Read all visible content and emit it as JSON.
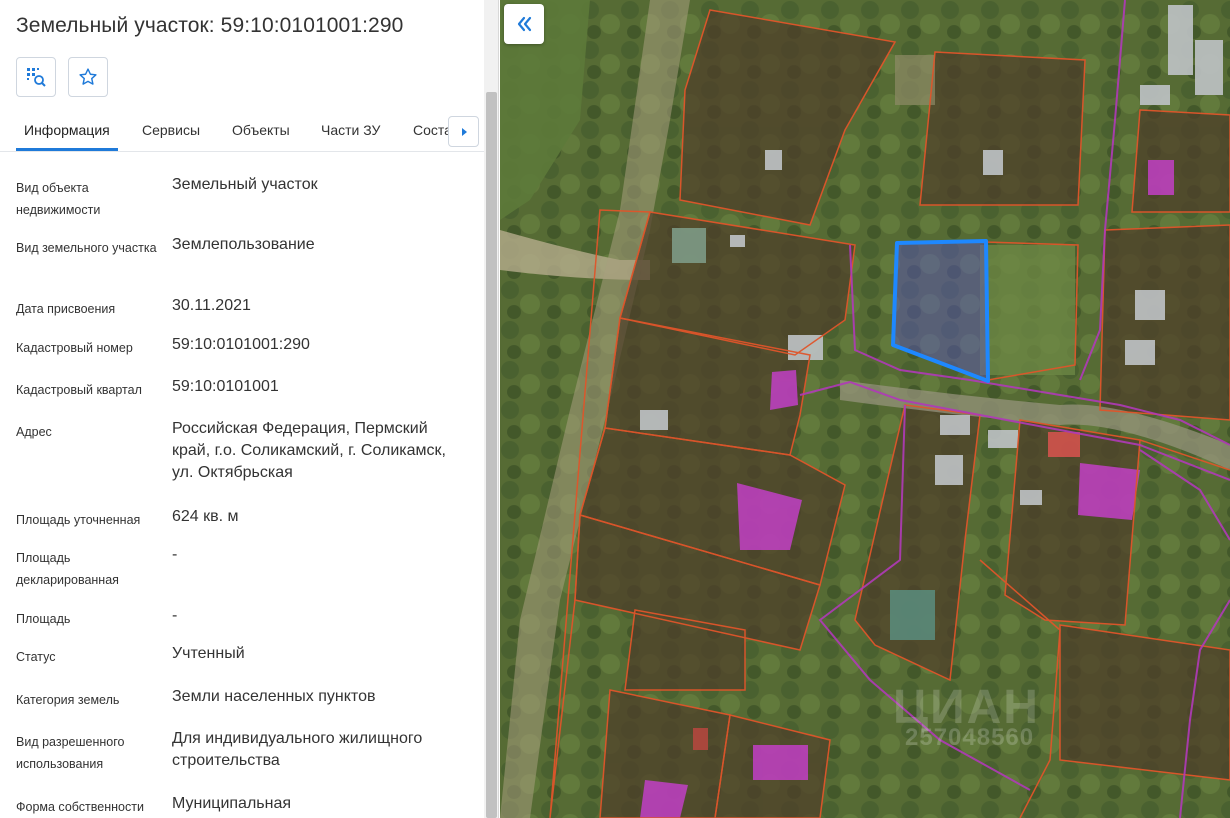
{
  "panel": {
    "title": "Земельный участок: 59:10:0101001:290",
    "tools": {
      "locate_icon": "map-locate-icon",
      "favorite_icon": "star-icon"
    },
    "tabs": [
      {
        "label": "Информация",
        "active": true
      },
      {
        "label": "Сервисы",
        "active": false
      },
      {
        "label": "Объекты",
        "active": false
      },
      {
        "label": "Части ЗУ",
        "active": false
      },
      {
        "label": "Соста",
        "active": false
      }
    ],
    "accent_color": "#1f7ad9"
  },
  "info": [
    {
      "label": "Вид объекта недвижимости",
      "value": "Земельный участок"
    },
    {
      "label": "Вид земельного участка",
      "value": "Землепользование"
    },
    {
      "label": "Дата присвоения",
      "value": "30.11.2021"
    },
    {
      "label": "Кадастровый номер",
      "value": "59:10:0101001:290"
    },
    {
      "label": "Кадастровый квартал",
      "value": "59:10:0101001"
    },
    {
      "label": "Адрес",
      "value": "Российская Федерация, Пермский край, г.о. Соликамский, г. Соликамск, ул. Октябрьская"
    },
    {
      "label": "Площадь уточненная",
      "value": "624 кв. м"
    },
    {
      "label": "Площадь декларированная",
      "value": "-"
    },
    {
      "label": "Площадь",
      "value": "-"
    },
    {
      "label": "Статус",
      "value": "Учтенный"
    },
    {
      "label": "Категория земель",
      "value": "Земли населенных пунктов"
    },
    {
      "label": "Вид разрешенного использования",
      "value": "Для индивидуального жилищного строительства"
    },
    {
      "label": "Форма собственности",
      "value": "Муниципальная"
    }
  ],
  "map": {
    "watermark_brand": "ЦИАН",
    "watermark_id": "257048560",
    "parcel_border_color": "#e0552a",
    "selected_parcel_color": "#1e88ff",
    "building_color": "#c93fd0",
    "boundary_line_color": "#b03ab8"
  }
}
